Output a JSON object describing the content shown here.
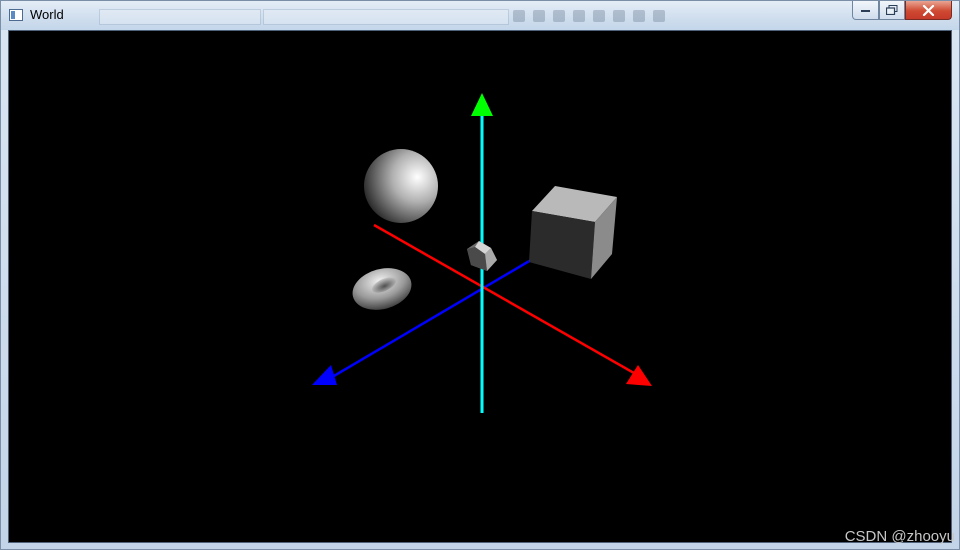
{
  "window": {
    "title": "World",
    "controls": {
      "minimize_icon": "minimize-icon",
      "maximize_icon": "restore-icon",
      "close_icon": "close-icon"
    }
  },
  "scene": {
    "background_color": "#000000",
    "axes": {
      "x_color": "#ff0000",
      "y_color": "#00ff00",
      "z_color": "#0000ff",
      "shaft_color": "#00ffff"
    },
    "objects": [
      "sphere",
      "cube",
      "torus",
      "small-polyhedron"
    ]
  },
  "watermark": "CSDN @zhooyu"
}
